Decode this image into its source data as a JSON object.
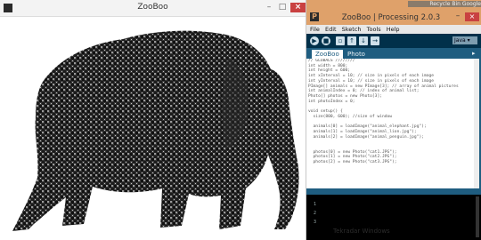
{
  "sketch": {
    "title": "ZooBoo",
    "minimize": "–",
    "maximize": "□",
    "close": "×"
  },
  "ide": {
    "title": "ZooBoo | Processing 2.0.3",
    "icon_letter": "P",
    "minimize": "–",
    "close": "×",
    "desktop_caption": "Recycle Bin   Google",
    "menu": [
      "File",
      "Edit",
      "Sketch",
      "Tools",
      "Help"
    ],
    "mode": "Java ▾",
    "tabs": [
      "ZooBoo",
      "Photo"
    ],
    "tab_arrow": "▸",
    "code": [
      "// GLOBALS ////////",
      "int width = 800;",
      "int height = 600;",
      "int xInterval = 10; // size in pixels of each image",
      "int yInterval = 10; // size in pixels of each image",
      "PImage[] animals = new PImage[3]; // array of animal pictures",
      "int animalIndex = 0; // index of animal list;",
      "Photo[] photos = new Photo[3];",
      "int photoIndex = 0;",
      "",
      "void setup() {",
      "  size(800, 600); //size of window",
      "",
      "  animals[0] = loadImage(\"animal_elephant.jpg\");",
      "  animals[1] = loadImage(\"animal_lion.jpg\");",
      "  animals[2] = loadImage(\"animal_penguin.jpg\");",
      "",
      "",
      "  photos[0] = new Photo(\"cat1.JPG\");",
      "  photos[1] = new Photo(\"cat2.JPG\");",
      "  photos[2] = new Photo(\"cat3.JPG\");"
    ],
    "console": [
      "1",
      "2",
      "3"
    ],
    "watermark": "Tekradar Windows"
  },
  "colors": {
    "ide_title_bar": "#dfa16a",
    "ide_body": "#1f5d80",
    "ide_toolbar": "#01304a",
    "close_red": "#c94141"
  }
}
